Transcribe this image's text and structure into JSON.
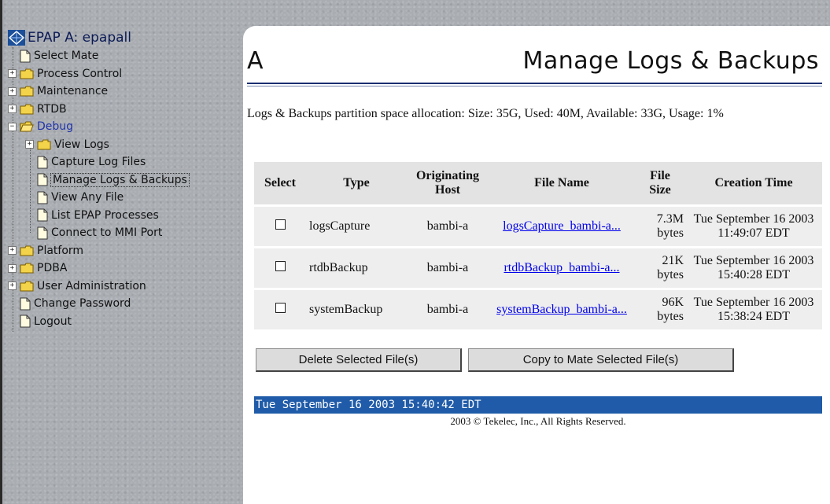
{
  "sidebar": {
    "app_title": "EPAP A: epapall",
    "items": [
      {
        "label": "Select Mate"
      },
      {
        "label": "Process Control"
      },
      {
        "label": "Maintenance"
      },
      {
        "label": "RTDB"
      },
      {
        "label": "Debug"
      },
      {
        "label": "View Logs"
      },
      {
        "label": "Capture Log Files"
      },
      {
        "label": "Manage Logs & Backups"
      },
      {
        "label": "View Any File"
      },
      {
        "label": "List EPAP Processes"
      },
      {
        "label": "Connect to MMI Port"
      },
      {
        "label": "Platform"
      },
      {
        "label": "PDBA"
      },
      {
        "label": "User Administration"
      },
      {
        "label": "Change Password"
      },
      {
        "label": "Logout"
      }
    ],
    "expander_plus": "+",
    "expander_minus": "−"
  },
  "main": {
    "side_letter": "A",
    "title": "Manage Logs & Backups",
    "info_text": "Logs & Backups partition space allocation: Size: 35G, Used: 40M, Available: 33G, Usage: 1%",
    "table": {
      "headers": [
        "Select",
        "Type",
        "Originating Host",
        "File Name",
        "File Size",
        "Creation Time"
      ],
      "rows": [
        {
          "type": "logsCapture",
          "host": "bambi-a",
          "file_name": "logsCapture_bambi-a...",
          "size": "7.3M bytes",
          "created": "Tue September 16 2003 11:49:07 EDT",
          "selected": false
        },
        {
          "type": "rtdbBackup",
          "host": "bambi-a",
          "file_name": "rtdbBackup_bambi-a...",
          "size": "21K bytes",
          "created": "Tue September 16 2003 15:40:28 EDT",
          "selected": false
        },
        {
          "type": "systemBackup",
          "host": "bambi-a",
          "file_name": "systemBackup_bambi-a...",
          "size": "96K bytes",
          "created": "Tue September 16 2003 15:38:24 EDT",
          "selected": false
        }
      ]
    },
    "buttons": {
      "delete": "Delete Selected File(s)",
      "copy": "Copy to Mate Selected File(s)"
    },
    "status_time": "Tue September 16 2003 15:40:42 EDT",
    "copyright": "2003 © Tekelec, Inc., All Rights Reserved."
  },
  "colors": {
    "status_bar": "#1f5ba8",
    "link": "#0000ee",
    "active_menu": "#2233aa"
  },
  "icons": [
    "app-logo-icon",
    "document-icon",
    "folder-icon",
    "folder-open-icon",
    "expand-icon",
    "collapse-icon",
    "checkbox-icon"
  ]
}
